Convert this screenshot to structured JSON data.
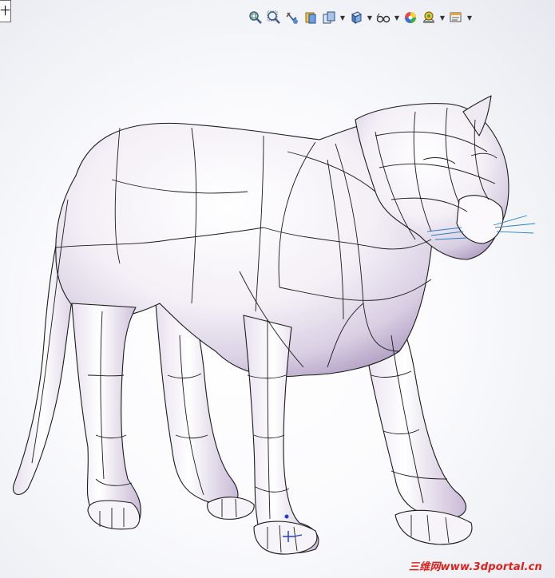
{
  "left_tab": {
    "text": "十"
  },
  "toolbar": {
    "buttons": [
      {
        "icon": "zoom-to-fit-icon"
      },
      {
        "icon": "zoom-to-area-icon"
      },
      {
        "icon": "previous-view-icon"
      },
      {
        "icon": "section-view-icon"
      },
      {
        "icon": "view-orientation-icon",
        "has_dropdown": true
      },
      {
        "icon": "display-style-icon",
        "has_dropdown": true
      },
      {
        "icon": "hide-show-items-icon",
        "has_dropdown": true
      },
      {
        "icon": "edit-appearance-icon",
        "has_dropdown": true
      },
      {
        "icon": "apply-scene-icon",
        "has_dropdown": true
      },
      {
        "icon": "view-settings-icon",
        "has_dropdown": true
      }
    ]
  },
  "watermark": {
    "text": "三维网www.3dportal.cn",
    "color": "#e0201b"
  },
  "model": {
    "description_icon": "panther-surface-model",
    "edge_color": "#1a1a1a",
    "surface_tint": "#d9cfe3"
  }
}
